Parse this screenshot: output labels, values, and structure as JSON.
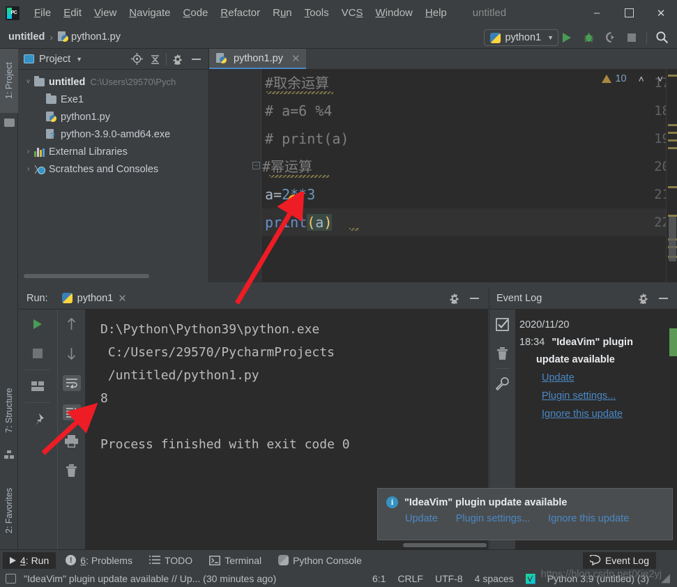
{
  "titlebar": {
    "logo": "pycharm-logo",
    "menu": [
      "File",
      "Edit",
      "View",
      "Navigate",
      "Code",
      "Refactor",
      "Run",
      "Tools",
      "VCS",
      "Window",
      "Help"
    ],
    "window_title": "untitled",
    "minimize": "–",
    "maximize": "❑",
    "close": "✕"
  },
  "navbar": {
    "project_crumb": "untitled",
    "separator": "›",
    "file_crumb": "python1.py",
    "run_config": "python1",
    "run_config_caret": "▼",
    "actions": [
      "run-icon",
      "debug-icon",
      "coverage-icon",
      "stop-icon",
      "search-icon"
    ]
  },
  "left_strip": {
    "project": "1: Project",
    "structure": "7: Structure",
    "favorites": "2: Favorites"
  },
  "project_panel": {
    "title": "Project",
    "caret": "▼",
    "tools": [
      "locate-icon",
      "collapse-all-icon",
      "gear-icon",
      "hide-icon"
    ],
    "tree": [
      {
        "arrow": "˅",
        "icon": "folder-icon",
        "label": "untitled",
        "path": "C:\\Users\\29570\\Pych",
        "bold": true,
        "indent": 0
      },
      {
        "arrow": "",
        "icon": "folder-icon",
        "label": "Exe1",
        "path": "",
        "bold": false,
        "indent": 1
      },
      {
        "arrow": "",
        "icon": "python-file-icon",
        "label": "python1.py",
        "path": "",
        "bold": false,
        "indent": 1
      },
      {
        "arrow": "",
        "icon": "python-unknown-file-icon",
        "label": "python-3.9.0-amd64.exe",
        "path": "",
        "bold": false,
        "indent": 1
      },
      {
        "arrow": "›",
        "icon": "libraries-icon",
        "label": "External Libraries",
        "path": "",
        "bold": false,
        "indent": 0
      },
      {
        "arrow": "›",
        "icon": "scratches-icon",
        "label": "Scratches and Consoles",
        "path": "",
        "bold": false,
        "indent": 0
      }
    ]
  },
  "editor": {
    "tab": {
      "label": "python1.py",
      "close": "✕",
      "icon": "python-file-icon"
    },
    "inspection": {
      "warning_count": "10",
      "up": "˄",
      "down": "˅",
      "warn_icon": "warning-triangle-icon"
    },
    "lines": [
      {
        "num": "17",
        "text": "#取余运算",
        "kind": "comment"
      },
      {
        "num": "18",
        "text": "# a=6 %4",
        "kind": "comment"
      },
      {
        "num": "19",
        "text": "# print(a)",
        "kind": "comment"
      },
      {
        "num": "20",
        "text": "#幂运算",
        "kind": "comment-fold"
      },
      {
        "num": "21",
        "text": "a=2**3",
        "kind": "code-assign"
      },
      {
        "num": "22",
        "text": "print(a)",
        "kind": "code-call"
      }
    ]
  },
  "run_panel": {
    "label": "Run:",
    "tab": "python1",
    "tab_close": "✕",
    "tools": [
      "gear-icon",
      "hide-icon"
    ],
    "side_tools": [
      "rerun-icon",
      "stop-icon",
      "layout-icon",
      "pin-icon"
    ],
    "side_tools2": [
      "up-arrow-icon",
      "down-arrow-icon",
      "soft-wrap-icon",
      "scroll-to-end-icon",
      "print-icon",
      "trash-icon"
    ],
    "console_lines": [
      "D:\\Python\\Python39\\python.exe",
      " C:/Users/29570/PycharmProjects",
      " /untitled/python1.py",
      "8",
      "",
      "Process finished with exit code 0"
    ],
    "output_value": "8"
  },
  "event_log": {
    "title": "Event Log",
    "tools": [
      "gear-icon",
      "hide-icon"
    ],
    "side_tools": [
      "mark-read-icon",
      "trash-icon",
      "settings-wrench-icon"
    ],
    "date": "2020/11/20",
    "time": "18:34",
    "message_line1": "\"IdeaVim\" plugin",
    "message_line2": "update available",
    "links": [
      "Update",
      "Plugin settings...",
      "Ignore this update"
    ]
  },
  "balloon": {
    "icon": "info-icon",
    "title": "\"IdeaVim\" plugin update available",
    "links": [
      "Update",
      "Plugin settings...",
      "Ignore this update"
    ]
  },
  "bottom_bar": {
    "items": [
      {
        "icon": "run-icon",
        "mnemonic": "4",
        "label": ": Run",
        "active": true
      },
      {
        "icon": "problems-icon",
        "mnemonic": "6",
        "label": ": Problems",
        "active": false
      },
      {
        "icon": "todo-icon",
        "mnemonic": "",
        "label": "TODO",
        "active": false
      },
      {
        "icon": "terminal-icon",
        "mnemonic": "",
        "label": "Terminal",
        "active": false
      },
      {
        "icon": "python-console-icon",
        "mnemonic": "",
        "label": "Python Console",
        "active": false
      }
    ],
    "right_item": {
      "icon": "event-log-icon",
      "label": "Event Log"
    }
  },
  "status_bar": {
    "message": "\"IdeaVim\" plugin update available // Up... (30 minutes ago)",
    "caret_position": "6:1",
    "line_separator": "CRLF",
    "encoding": "UTF-8",
    "indent": "4 spaces",
    "vcs_icon": "git-branch-icon",
    "interpreter": "Python 3.9 (untitled) (3)"
  },
  "watermark": "https://blog.csdn.net/Xie2yj",
  "colors": {
    "panel_bg": "#3c3f41",
    "editor_bg": "#2b2b2b",
    "gutter_bg": "#313335",
    "accent_blue": "#4a88c7",
    "link_blue": "#4a88c7",
    "green_run": "#499c54",
    "warn_amber": "#a9883e",
    "keyword_blue": "#6897bb",
    "comment_gray": "#808080",
    "text_default": "#a9b7c6",
    "paren_yellow": "#ffc66d",
    "arrow_red": "#ee1c25"
  }
}
